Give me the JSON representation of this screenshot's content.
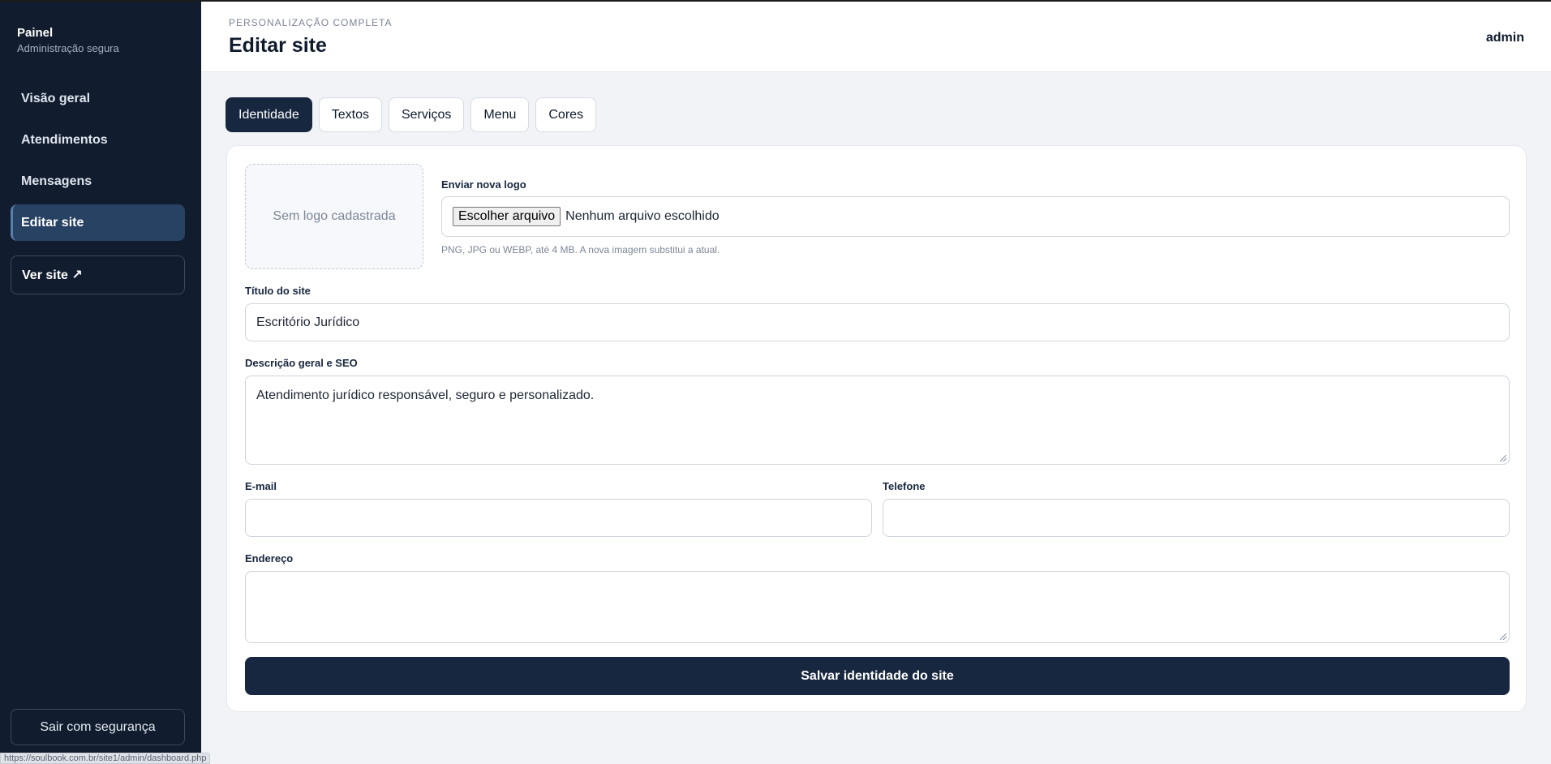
{
  "sidebar": {
    "brand_title": "Painel",
    "brand_subtitle": "Administração segura",
    "items": [
      {
        "label": "Visão geral",
        "active": false
      },
      {
        "label": "Atendimentos",
        "active": false
      },
      {
        "label": "Mensagens",
        "active": false
      },
      {
        "label": "Editar site",
        "active": true
      }
    ],
    "view_site_label": "Ver site ↗",
    "logout_label": "Sair com segurança"
  },
  "header": {
    "kicker": "PERSONALIZAÇÃO COMPLETA",
    "title": "Editar site",
    "user": "admin"
  },
  "tabs": [
    {
      "label": "Identidade",
      "active": true
    },
    {
      "label": "Textos",
      "active": false
    },
    {
      "label": "Serviços",
      "active": false
    },
    {
      "label": "Menu",
      "active": false
    },
    {
      "label": "Cores",
      "active": false
    }
  ],
  "form": {
    "logo_placeholder": "Sem logo cadastrada",
    "logo_label": "Enviar nova logo",
    "file_button": "Escolher arquivo",
    "file_status": "Nenhum arquivo escolhido",
    "logo_hint": "PNG, JPG ou WEBP, até 4 MB. A nova imagem substitui a atual.",
    "title_label": "Título do site",
    "title_value": "Escritório Jurídico",
    "description_label": "Descrição geral e SEO",
    "description_value": "Atendimento jurídico responsável, seguro e personalizado.",
    "email_label": "E-mail",
    "email_value": "",
    "phone_label": "Telefone",
    "phone_value": "",
    "address_label": "Endereço",
    "address_value": "",
    "save_label": "Salvar identidade do site"
  },
  "status_url": "https://soulbook.com.br/site1/admin/dashboard.php",
  "colors": {
    "sidebar_bg": "#111c2e",
    "primary": "#17273f",
    "active_nav": "#284263",
    "page_bg": "#f1f3f7"
  }
}
